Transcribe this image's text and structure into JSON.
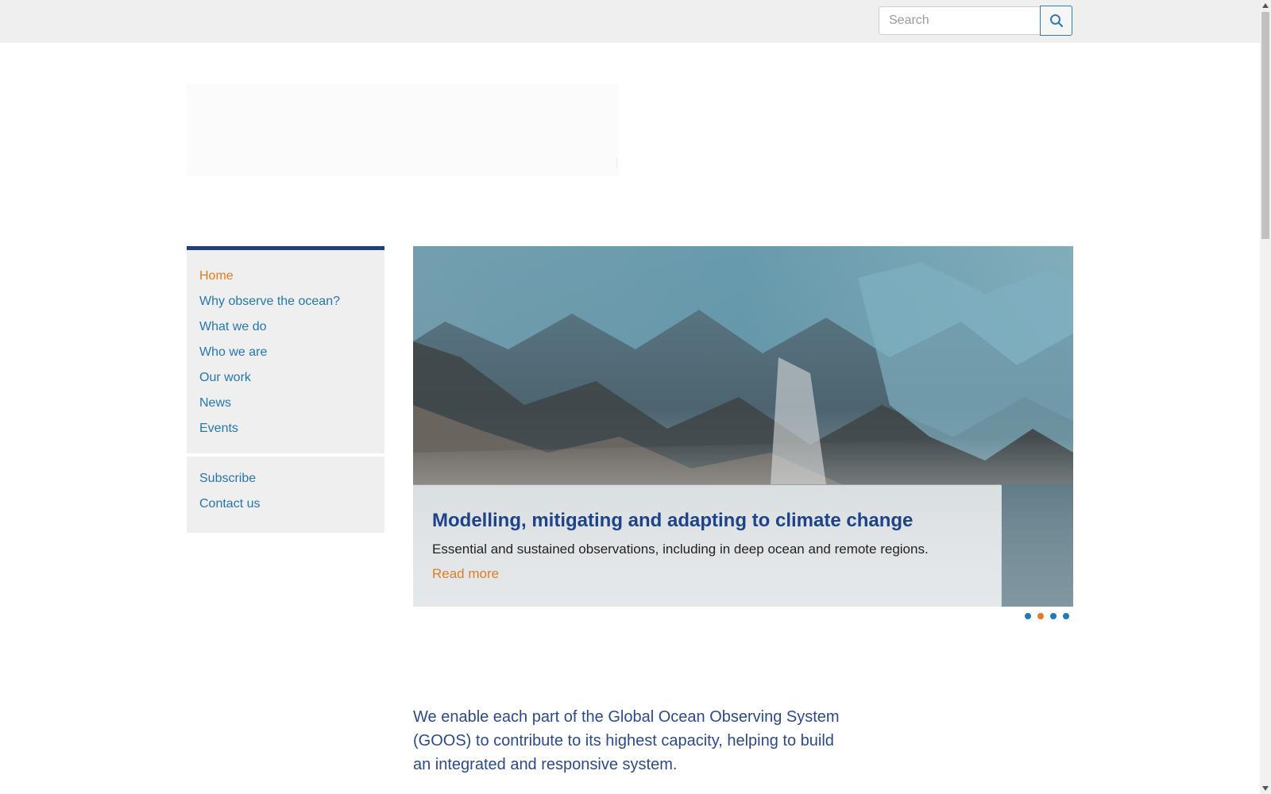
{
  "search": {
    "placeholder": "Search"
  },
  "nav": {
    "main": [
      {
        "label": "Home",
        "active": true
      },
      {
        "label": "Why observe the ocean?"
      },
      {
        "label": "What we do"
      },
      {
        "label": "Who we are"
      },
      {
        "label": "Our work"
      },
      {
        "label": "News"
      },
      {
        "label": "Events"
      }
    ],
    "secondary": [
      {
        "label": "Subscribe"
      },
      {
        "label": "Contact us"
      }
    ]
  },
  "hero": {
    "title": "Modelling, mitigating and adapting to climate change",
    "text": "Essential and sustained observations, including in deep ocean and remote regions.",
    "link_label": "Read more",
    "slide_count": 4,
    "active_slide": 2
  },
  "intro": {
    "text": "We enable each part of the Global Ocean Observing System (GOOS) to contribute to its highest capacity, helping to build an integrated and responsive system."
  },
  "colors": {
    "link": "#2677b0",
    "active": "#e07d23",
    "heading": "#1e4389",
    "nav_border": "#1e3f7e"
  }
}
